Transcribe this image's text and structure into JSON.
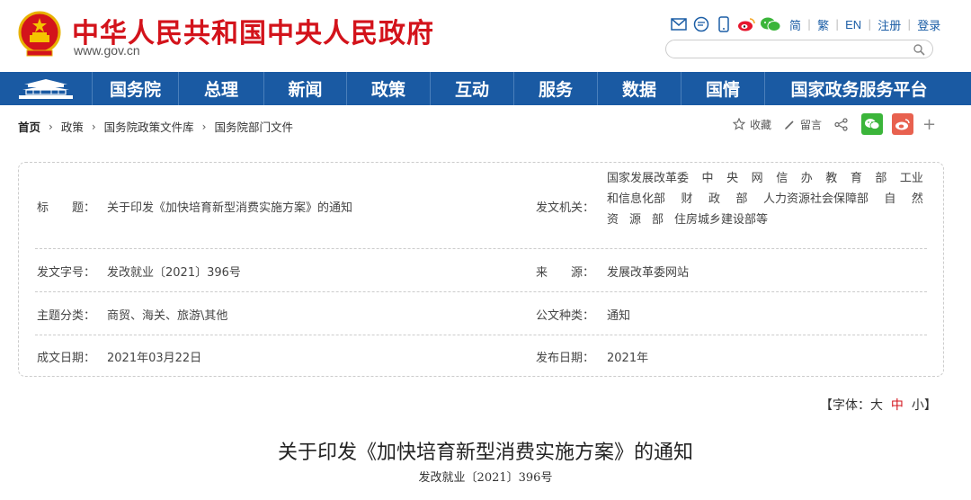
{
  "header": {
    "site_title": "中华人民共和国中央人民政府",
    "domain": "www.gov.cn",
    "links": [
      "简",
      "繁",
      "EN",
      "注册",
      "登录"
    ],
    "search_placeholder": ""
  },
  "nav": {
    "items": [
      "国务院",
      "总理",
      "新闻",
      "政策",
      "互动",
      "服务",
      "数据",
      "国情",
      "国家政务服务平台"
    ]
  },
  "breadcrumb": [
    "首页",
    "政策",
    "国务院政策文件库",
    "国务院部门文件"
  ],
  "tools": {
    "favorite": "收藏",
    "comment": "留言",
    "plus": "+"
  },
  "info": {
    "title_label": "标　　题：",
    "title_value": "关于印发《加快培育新型消费实施方案》的通知",
    "issuer_label": "发文机关：",
    "issuer_lines": [
      [
        "国家发展改革委",
        "中",
        "央",
        "网",
        "信",
        "办",
        "教",
        "育",
        "部",
        "工业"
      ],
      [
        "和信息化部",
        "财",
        "政",
        "部",
        "人力资源社会保障部",
        "自",
        "然"
      ],
      [
        "资",
        "源",
        "部",
        "住房城乡建设部等"
      ]
    ],
    "docno_label": "发文字号：",
    "docno_value": "发改就业〔2021〕396号",
    "source_label": "来　　源：",
    "source_value": "发展改革委网站",
    "topic_label": "主题分类：",
    "topic_value": "商贸、海关、旅游\\其他",
    "type_label": "公文种类：",
    "type_value": "通知",
    "written_label": "成文日期：",
    "written_value": "2021年03月22日",
    "published_label": "发布日期：",
    "published_value": "2021年"
  },
  "fontctl": {
    "prefix": "【字体：",
    "big": "大",
    "mid": "中",
    "small": "小",
    "suffix": "】"
  },
  "document": {
    "title": "关于印发《加快培育新型消费实施方案》的通知",
    "number": "发改就业〔2021〕396号"
  },
  "colors": {
    "brand_red": "#d3131b",
    "nav_blue": "#1a5aa3"
  }
}
